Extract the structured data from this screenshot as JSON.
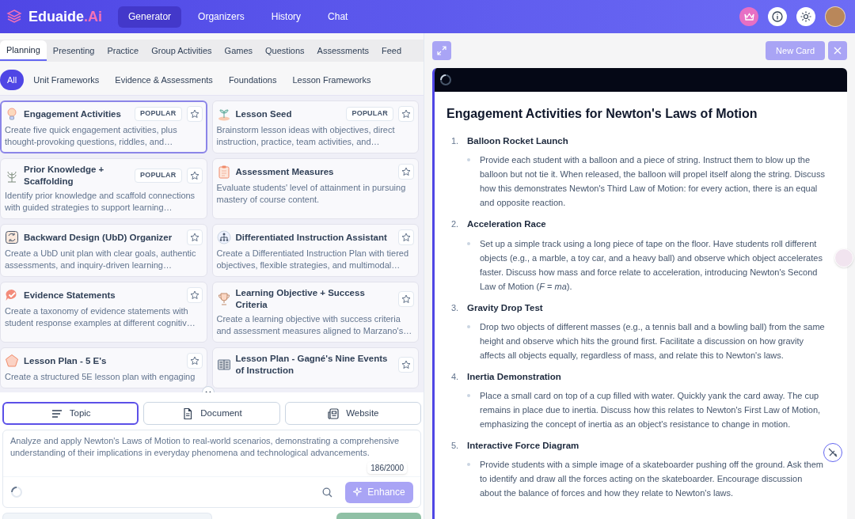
{
  "header": {
    "logo": {
      "name": "Eduaide",
      "suffix": ".Ai"
    },
    "nav": [
      {
        "label": "Generator",
        "selected": true
      },
      {
        "label": "Organizers",
        "selected": false
      },
      {
        "label": "History",
        "selected": false
      },
      {
        "label": "Chat",
        "selected": false
      }
    ]
  },
  "category_tabs": [
    {
      "label": "Planning",
      "selected": true
    },
    {
      "label": "Presenting",
      "selected": false
    },
    {
      "label": "Practice",
      "selected": false
    },
    {
      "label": "Group Activities",
      "selected": false
    },
    {
      "label": "Games",
      "selected": false
    },
    {
      "label": "Questions",
      "selected": false
    },
    {
      "label": "Assessments",
      "selected": false
    },
    {
      "label": "Feed",
      "selected": false
    }
  ],
  "filters": [
    {
      "label": "All",
      "selected": true
    },
    {
      "label": "Unit Frameworks",
      "selected": false
    },
    {
      "label": "Evidence & Assessments",
      "selected": false
    },
    {
      "label": "Foundations",
      "selected": false
    },
    {
      "label": "Lesson Frameworks",
      "selected": false
    }
  ],
  "tools": [
    {
      "kind": "bulb",
      "title": "Engagement Activities",
      "badge": "POPULAR",
      "selected": true,
      "description": "Create five quick engagement activities, plus thought-provoking questions, riddles, and…"
    },
    {
      "kind": "sprout",
      "title": "Lesson Seed",
      "badge": "POPULAR",
      "selected": false,
      "description": "Brainstorm lesson ideas with objectives, direct instruction, practice, team activities, and…"
    },
    {
      "kind": "plant",
      "title": "Prior Knowledge + Scaffolding",
      "badge": "POPULAR",
      "selected": false,
      "description": "Identify prior knowledge and scaffold connections with guided strategies to support learning…"
    },
    {
      "kind": "clipboard",
      "title": "Assessment Measures",
      "selected": false,
      "description": "Evaluate students' level of attainment in pursuing mastery of course content."
    },
    {
      "kind": "cycle",
      "title": "Backward Design (UbD) Organizer",
      "selected": false,
      "description": "Create a UbD unit plan with clear goals, authentic assessments, and inquiry-driven learning…"
    },
    {
      "kind": "hierarchy",
      "title": "Differentiated Instruction Assistant",
      "selected": false,
      "description": "Create a Differentiated Instruction Plan with tiered objectives, flexible strategies, and multimodal…"
    },
    {
      "kind": "check",
      "title": "Evidence Statements",
      "selected": false,
      "description": "Create a taxonomy of evidence statements with student response examples at different cognitiv…"
    },
    {
      "kind": "trophy",
      "title": "Learning Objective + Success Criteria",
      "selected": false,
      "description": "Create a learning objective with success criteria and assessment measures aligned to Marzano's…"
    },
    {
      "kind": "pentagon",
      "title": "Lesson Plan - 5 E's",
      "selected": false,
      "description": "Create a structured 5E lesson plan with engaging"
    },
    {
      "kind": "book",
      "title": "Lesson Plan - Gagné's Nine Events of Instruction",
      "selected": false
    }
  ],
  "sources": [
    {
      "kind": "topic",
      "label": "Topic",
      "selected": true
    },
    {
      "kind": "document",
      "label": "Document",
      "selected": false
    },
    {
      "kind": "website",
      "label": "Website",
      "selected": false
    }
  ],
  "prompt": {
    "value": "Analyze and apply Newton's Laws of Motion to real-world scenarios, demonstrating a comprehensive understanding of their implications in everyday phenomena and technological advancements.",
    "counter": "186/2000",
    "enhance": "Enhance"
  },
  "output": {
    "new_card": "New Card",
    "title": "Engagement Activities for Newton's Laws of Motion",
    "items": [
      {
        "number": "1.",
        "heading": "Balloon Rocket Launch",
        "text": "Provide each student with a balloon and a piece of string. Instruct them to blow up the balloon but not tie it. When released, the balloon will propel itself along the string. Discuss how this demonstrates Newton's Third Law of Motion: for every action, there is an equal and opposite reaction."
      },
      {
        "number": "2.",
        "heading": "Acceleration Race",
        "text": "Set up a simple track using a long piece of tape on the floor. Have students roll different objects (e.g., a marble, a toy car, and a heavy ball) and observe which object accelerates faster. Discuss how mass and force relate to acceleration, introducing Newton's Second Law of Motion (*F* = *ma*)."
      },
      {
        "number": "3.",
        "heading": "Gravity Drop Test",
        "text": "Drop two objects of different masses (e.g., a tennis ball and a bowling ball) from the same height and observe which hits the ground first. Facilitate a discussion on how gravity affects all objects equally, regardless of mass, and relate this to Newton's laws."
      },
      {
        "number": "4.",
        "heading": "Inertia Demonstration",
        "text": "Place a small card on top of a cup filled with water. Quickly yank the card away. The cup remains in place due to inertia. Discuss how this relates to Newton's First Law of Motion, emphasizing the concept of inertia as an object's resistance to change in motion."
      },
      {
        "number": "5.",
        "heading": "Interactive Force Diagram",
        "text": "Provide students with a simple image of a skateboarder pushing off the ground. Ask them to identify and draw all the forces acting on the skateboarder. Encourage discussion about the balance of forces and how they relate to Newton's laws."
      }
    ]
  }
}
